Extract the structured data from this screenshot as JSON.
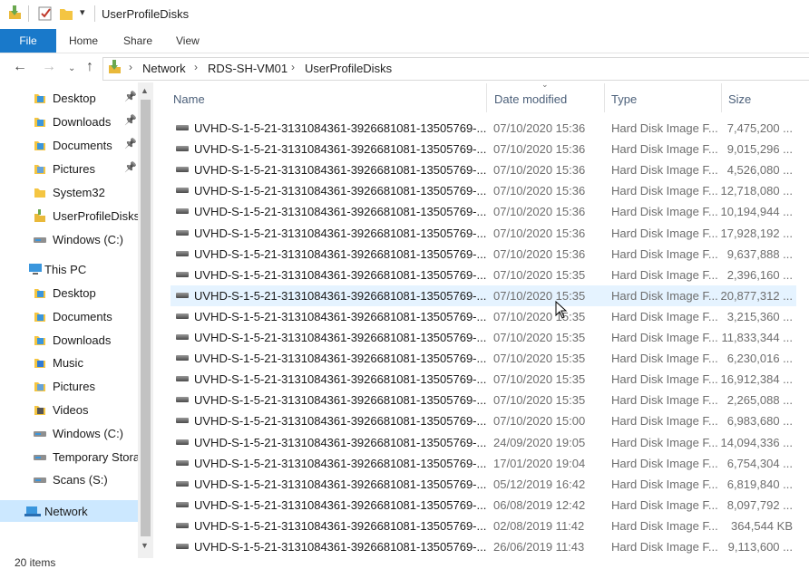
{
  "window": {
    "title": "UserProfileDisks"
  },
  "ribbon": {
    "file": "File",
    "tabs": [
      "Home",
      "Share",
      "View"
    ]
  },
  "address": {
    "crumbs": [
      "Network",
      "RDS-SH-VM01",
      "UserProfileDisks"
    ]
  },
  "sidebar": {
    "quick_access": [
      {
        "label": "Desktop",
        "icon": "desktop-folder-icon",
        "pinned": true
      },
      {
        "label": "Downloads",
        "icon": "downloads-folder-icon",
        "pinned": true
      },
      {
        "label": "Documents",
        "icon": "documents-folder-icon",
        "pinned": true
      },
      {
        "label": "Pictures",
        "icon": "pictures-folder-icon",
        "pinned": true
      },
      {
        "label": "System32",
        "icon": "folder-icon",
        "pinned": false
      },
      {
        "label": "UserProfileDisks",
        "icon": "network-folder-icon",
        "pinned": false
      },
      {
        "label": "Windows (C:)",
        "icon": "drive-icon",
        "pinned": false
      }
    ],
    "this_pc": "This PC",
    "this_pc_items": [
      {
        "label": "Desktop",
        "icon": "desktop-folder-icon"
      },
      {
        "label": "Documents",
        "icon": "documents-folder-icon"
      },
      {
        "label": "Downloads",
        "icon": "downloads-folder-icon"
      },
      {
        "label": "Music",
        "icon": "music-folder-icon"
      },
      {
        "label": "Pictures",
        "icon": "pictures-folder-icon"
      },
      {
        "label": "Videos",
        "icon": "videos-folder-icon"
      },
      {
        "label": "Windows (C:)",
        "icon": "drive-icon"
      },
      {
        "label": "Temporary Stora",
        "icon": "drive-icon"
      },
      {
        "label": "Scans (S:)",
        "icon": "network-drive-icon"
      }
    ],
    "network": "Network"
  },
  "columns": {
    "name": "Name",
    "date": "Date modified",
    "type": "Type",
    "size": "Size"
  },
  "files": [
    {
      "name": "UVHD-S-1-5-21-3131084361-3926681081-13505769-...",
      "date": "07/10/2020 15:36",
      "type": "Hard Disk Image F...",
      "size": "7,475,200 ..."
    },
    {
      "name": "UVHD-S-1-5-21-3131084361-3926681081-13505769-...",
      "date": "07/10/2020 15:36",
      "type": "Hard Disk Image F...",
      "size": "9,015,296 ..."
    },
    {
      "name": "UVHD-S-1-5-21-3131084361-3926681081-13505769-...",
      "date": "07/10/2020 15:36",
      "type": "Hard Disk Image F...",
      "size": "4,526,080 ..."
    },
    {
      "name": "UVHD-S-1-5-21-3131084361-3926681081-13505769-...",
      "date": "07/10/2020 15:36",
      "type": "Hard Disk Image F...",
      "size": "12,718,080 ..."
    },
    {
      "name": "UVHD-S-1-5-21-3131084361-3926681081-13505769-...",
      "date": "07/10/2020 15:36",
      "type": "Hard Disk Image F...",
      "size": "10,194,944 ..."
    },
    {
      "name": "UVHD-S-1-5-21-3131084361-3926681081-13505769-...",
      "date": "07/10/2020 15:36",
      "type": "Hard Disk Image F...",
      "size": "17,928,192 ..."
    },
    {
      "name": "UVHD-S-1-5-21-3131084361-3926681081-13505769-...",
      "date": "07/10/2020 15:36",
      "type": "Hard Disk Image F...",
      "size": "9,637,888 ..."
    },
    {
      "name": "UVHD-S-1-5-21-3131084361-3926681081-13505769-...",
      "date": "07/10/2020 15:35",
      "type": "Hard Disk Image F...",
      "size": "2,396,160 ..."
    },
    {
      "name": "UVHD-S-1-5-21-3131084361-3926681081-13505769-...",
      "date": "07/10/2020 15:35",
      "type": "Hard Disk Image F...",
      "size": "20,877,312 ..."
    },
    {
      "name": "UVHD-S-1-5-21-3131084361-3926681081-13505769-...",
      "date": "07/10/2020 15:35",
      "type": "Hard Disk Image F...",
      "size": "3,215,360 ..."
    },
    {
      "name": "UVHD-S-1-5-21-3131084361-3926681081-13505769-...",
      "date": "07/10/2020 15:35",
      "type": "Hard Disk Image F...",
      "size": "11,833,344 ..."
    },
    {
      "name": "UVHD-S-1-5-21-3131084361-3926681081-13505769-...",
      "date": "07/10/2020 15:35",
      "type": "Hard Disk Image F...",
      "size": "6,230,016 ..."
    },
    {
      "name": "UVHD-S-1-5-21-3131084361-3926681081-13505769-...",
      "date": "07/10/2020 15:35",
      "type": "Hard Disk Image F...",
      "size": "16,912,384 ..."
    },
    {
      "name": "UVHD-S-1-5-21-3131084361-3926681081-13505769-...",
      "date": "07/10/2020 15:35",
      "type": "Hard Disk Image F...",
      "size": "2,265,088 ..."
    },
    {
      "name": "UVHD-S-1-5-21-3131084361-3926681081-13505769-...",
      "date": "07/10/2020 15:00",
      "type": "Hard Disk Image F...",
      "size": "6,983,680 ..."
    },
    {
      "name": "UVHD-S-1-5-21-3131084361-3926681081-13505769-...",
      "date": "24/09/2020 19:05",
      "type": "Hard Disk Image F...",
      "size": "14,094,336 ..."
    },
    {
      "name": "UVHD-S-1-5-21-3131084361-3926681081-13505769-...",
      "date": "17/01/2020 19:04",
      "type": "Hard Disk Image F...",
      "size": "6,754,304 ..."
    },
    {
      "name": "UVHD-S-1-5-21-3131084361-3926681081-13505769-...",
      "date": "05/12/2019 16:42",
      "type": "Hard Disk Image F...",
      "size": "6,819,840 ..."
    },
    {
      "name": "UVHD-S-1-5-21-3131084361-3926681081-13505769-...",
      "date": "06/08/2019 12:42",
      "type": "Hard Disk Image F...",
      "size": "8,097,792 ..."
    },
    {
      "name": "UVHD-S-1-5-21-3131084361-3926681081-13505769-...",
      "date": "02/08/2019 11:42",
      "type": "Hard Disk Image F...",
      "size": "364,544 KB"
    },
    {
      "name": "UVHD-S-1-5-21-3131084361-3926681081-13505769-...",
      "date": "26/06/2019 11:43",
      "type": "Hard Disk Image F...",
      "size": "9,113,600 ..."
    }
  ],
  "hovered_row": 8,
  "status": {
    "items": "20 items"
  },
  "colors": {
    "accent": "#1979ca",
    "hover": "#e5f3ff",
    "selected": "#cce8ff",
    "folder": "#f4c542"
  }
}
